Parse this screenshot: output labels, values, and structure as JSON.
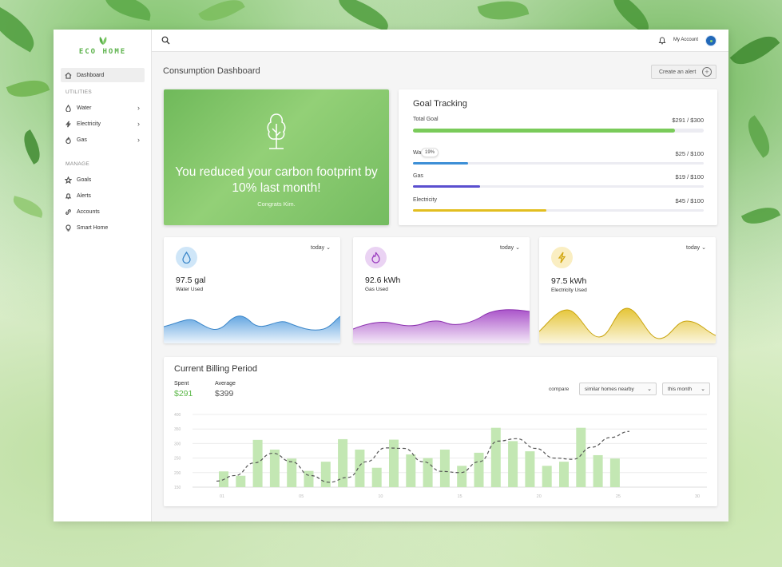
{
  "app": {
    "brand": "ECO HOME"
  },
  "sidebar": {
    "items": [
      {
        "label": "Dashboard",
        "icon": "home-icon",
        "active": true
      },
      {
        "label": "Water",
        "icon": "water-drop-icon"
      },
      {
        "label": "Electricity",
        "icon": "lightning-icon"
      },
      {
        "label": "Gas",
        "icon": "flame-icon"
      },
      {
        "label": "Goals",
        "icon": "star-icon"
      },
      {
        "label": "Alerts",
        "icon": "bell-icon"
      },
      {
        "label": "Accounts",
        "icon": "link-icon"
      },
      {
        "label": "Smart Home",
        "icon": "bulb-icon"
      }
    ],
    "sections": {
      "utilities": "UTILITIES",
      "manage": "MANAGE"
    }
  },
  "topbar": {
    "account_label": "My Account"
  },
  "page": {
    "title": "Consumption Dashboard",
    "create_alert": "Create an alert"
  },
  "hero": {
    "message": "You reduced your carbon footprint by 10% last month!",
    "sub": "Congrats Kim."
  },
  "goals": {
    "title": "Goal Tracking",
    "items": [
      {
        "label": "Total Goal",
        "value": "$291 / $300",
        "progress": 0.9,
        "color": "#7acb5a"
      },
      {
        "label": "Water",
        "value": "$25 / $100",
        "progress": 0.19,
        "color": "#3d8fd6"
      },
      {
        "label": "Gas",
        "value": "$19 / $100",
        "progress": 0.23,
        "color": "#5a4fcf"
      },
      {
        "label": "Electricity",
        "value": "$45 / $100",
        "progress": 0.46,
        "color": "#e2be20"
      }
    ],
    "water_tooltip": "19%"
  },
  "utility_cards": [
    {
      "amount": "97.5 gal",
      "label": "Water Used",
      "period": "today",
      "icon": "water-drop-icon",
      "color": "#4a97dc",
      "icon_bg": "#cfe6f8"
    },
    {
      "amount": "92.6 kWh",
      "label": "Gas Used",
      "period": "today",
      "icon": "flame-icon",
      "color": "#a142c4",
      "icon_bg": "#ead3f3"
    },
    {
      "amount": "97.5 kWh",
      "label": "Electricity Used",
      "period": "today",
      "icon": "lightning-icon",
      "color": "#e2be20",
      "icon_bg": "#faeec2"
    }
  ],
  "billing": {
    "title": "Current Billing Period",
    "spent_label": "Spent",
    "spent_value": "$291",
    "average_label": "Average",
    "average_value": "$399",
    "compare_label": "compare",
    "compare_select": "similar homes nearby",
    "period_select": "this month"
  },
  "chart_data": {
    "type": "bar",
    "y_ticks": [
      "400",
      "350",
      "300",
      "250",
      "200",
      "150"
    ],
    "x_ticks": [
      "01",
      "05",
      "10",
      "15",
      "20",
      "25",
      "30"
    ],
    "ylim": [
      100,
      400
    ],
    "values": [
      165,
      147,
      295,
      255,
      218,
      167,
      205,
      298,
      255,
      180,
      296,
      235,
      220,
      255,
      188,
      242,
      345,
      290,
      248,
      188,
      205,
      345,
      232,
      218
    ],
    "trend": [
      125,
      148,
      200,
      240,
      205,
      148,
      120,
      140,
      205,
      262,
      260,
      205,
      165,
      160,
      205,
      290,
      300,
      260,
      220,
      215,
      265,
      305,
      330
    ],
    "bar_color": "#c3e7b3",
    "trend_color": "#555555"
  }
}
